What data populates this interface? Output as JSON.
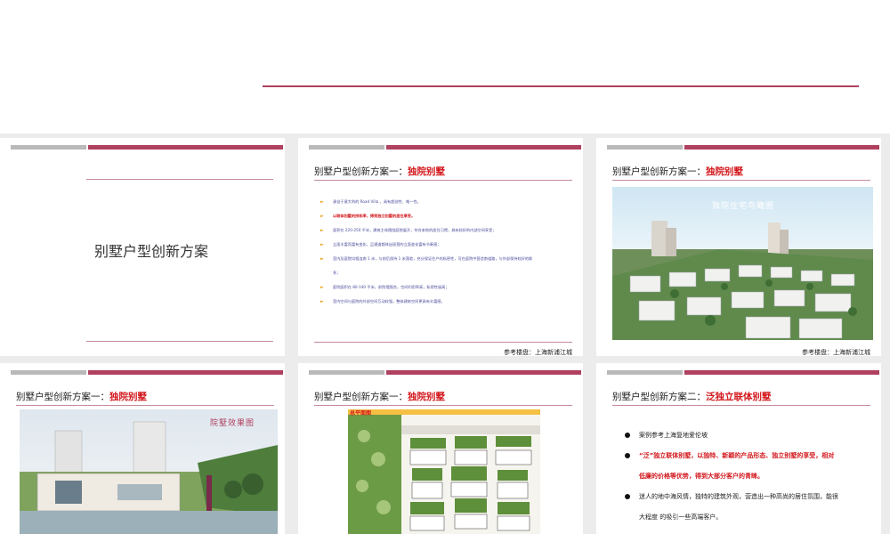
{
  "slides": {
    "cover": {
      "title": "别墅户型创新方案"
    },
    "s2": {
      "title_prefix": "别墅户型创新方案一：",
      "title_highlight": "独院别墅",
      "bullets": [
        {
          "text": "源自于意大利的 Road Villa ，具有超创性、唯一性。",
          "red": false,
          "marker": true
        },
        {
          "text": "以联体别墅的拼和率，得到独立别墅的居住享受。",
          "red": true,
          "marker": true
        },
        {
          "text": "面积在 220-250 平米，建筑主体围绕庭院展开，符合本地的居住习惯，具有较好的内部空间享受；",
          "red": false,
          "marker": true
        },
        {
          "text": "立面丰富而富有变化，且通道都体出现营的立面变化富有节奏感；",
          "red": false,
          "marker": true
        },
        {
          "text": "室内及庭院均相连南 1 米，与前后保持 1 米落差，充分保证住户的私密性，可在庭院中营造南道路，与外部保持较好的联",
          "red": false,
          "marker": true
        },
        {
          "text": "系；",
          "red": false,
          "marker": false
        },
        {
          "text": "庭院面积在 80-140 平米，前院墙围合，空间利用率高，私密性极高；",
          "red": false,
          "marker": true
        },
        {
          "text": "室内空间与庭院的外部空间互动较强，整体建筑空间更具有丰富感。",
          "red": false,
          "marker": true
        }
      ],
      "ref": "参考楼盘：上海新浦江城"
    },
    "s3": {
      "title_prefix": "别墅户型创新方案一：",
      "title_highlight": "独院别墅",
      "caption": "独院住宅鸟瞰图",
      "ref": "参考楼盘：上海新浦江城"
    },
    "s4": {
      "title_prefix": "别墅户型创新方案一：",
      "title_highlight": "独院别墅",
      "caption": "院墅效果图"
    },
    "s5": {
      "title_prefix": "别墅户型创新方案一：",
      "title_highlight": "独院别墅",
      "caption": "总平面图"
    },
    "s6": {
      "title_prefix": "别墅户型创新方案二：",
      "title_highlight": "泛独立联体别墅",
      "bullets": [
        {
          "text": "案例参考上海复地爱伦坡",
          "red": false,
          "marker": true
        },
        {
          "text": "“泛”独立联体别墅，以独特、新颖的产品形态、独立别墅的享受，相对",
          "red": true,
          "marker": true
        },
        {
          "text": "低廉的价格等优势，得到大部分客户的青睐。",
          "red": true,
          "marker": false
        },
        {
          "text": "迷人的地中海风情，独特的建筑外观，营造出一种高尚的居住氛围，能很",
          "red": false,
          "marker": true
        },
        {
          "text": "大程度 的吸引一些高端客户。",
          "red": false,
          "marker": false
        },
        {
          "text": "社区内丰富的绿化景观，营造了自然的居住环境。",
          "red": false,
          "marker": true
        }
      ]
    }
  },
  "colors": {
    "accent": "#b0405f",
    "highlight": "#d2161b",
    "bullet_marker": "#e8a21a",
    "gray_bar": "#b9b9b9"
  }
}
